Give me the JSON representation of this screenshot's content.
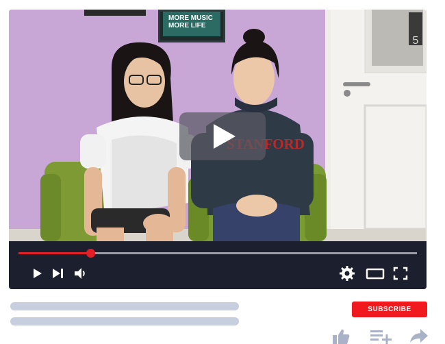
{
  "video": {
    "poster_text_line1": "MORE MUSIC",
    "poster_text_line2": "MORE LIFE",
    "door_sign": "5",
    "sweatshirt_text": "STANFORD",
    "progress": 0.18
  },
  "controls": {
    "play_icon": "play-icon",
    "next_icon": "next-icon",
    "volume_icon": "volume-icon",
    "settings_icon": "gear-icon",
    "theater_icon": "theater-mode-icon",
    "fullscreen_icon": "fullscreen-icon"
  },
  "actions": {
    "subscribe_label": "SUBSCRIBE",
    "like_icon": "thumbs-up-icon",
    "save_icon": "add-to-playlist-icon",
    "share_icon": "share-icon"
  },
  "colors": {
    "accent": "#e31e24",
    "control_bar": "#1c1f2e",
    "placeholder": "#c7cfdf",
    "subscribe": "#f0191d"
  }
}
